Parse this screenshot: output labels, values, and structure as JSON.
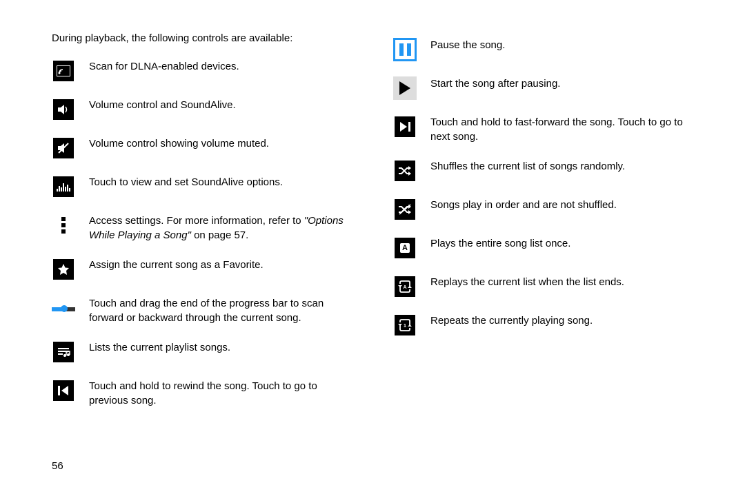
{
  "intro": "During playback, the following controls are available:",
  "page_number": "56",
  "left": {
    "i0": "Scan for DLNA-enabled devices.",
    "i1": "Volume control and SoundAlive.",
    "i2": "Volume control showing volume muted.",
    "i3": "Touch to view and set SoundAlive options.",
    "i4_a": "Access settings. For more information, refer to ",
    "i4_b": "\"Options While Playing a Song\"",
    "i4_c": " on page 57.",
    "i5": "Assign the current song as a Favorite.",
    "i6": "Touch and drag the end of the progress bar to scan forward or backward through the current song.",
    "i7": "Lists the current playlist songs.",
    "i8": "Touch and hold to rewind the song. Touch to go to previous song."
  },
  "right": {
    "i0": "Pause the song.",
    "i1": "Start the song after pausing.",
    "i2": "Touch and hold to fast-forward the song. Touch to go to next song.",
    "i3": "Shuffles the current list of songs randomly.",
    "i4": "Songs play in order and are not shuffled.",
    "i5": "Plays the entire song list once.",
    "i6": "Replays the current list when the list ends.",
    "i7": "Repeats the currently playing song."
  }
}
